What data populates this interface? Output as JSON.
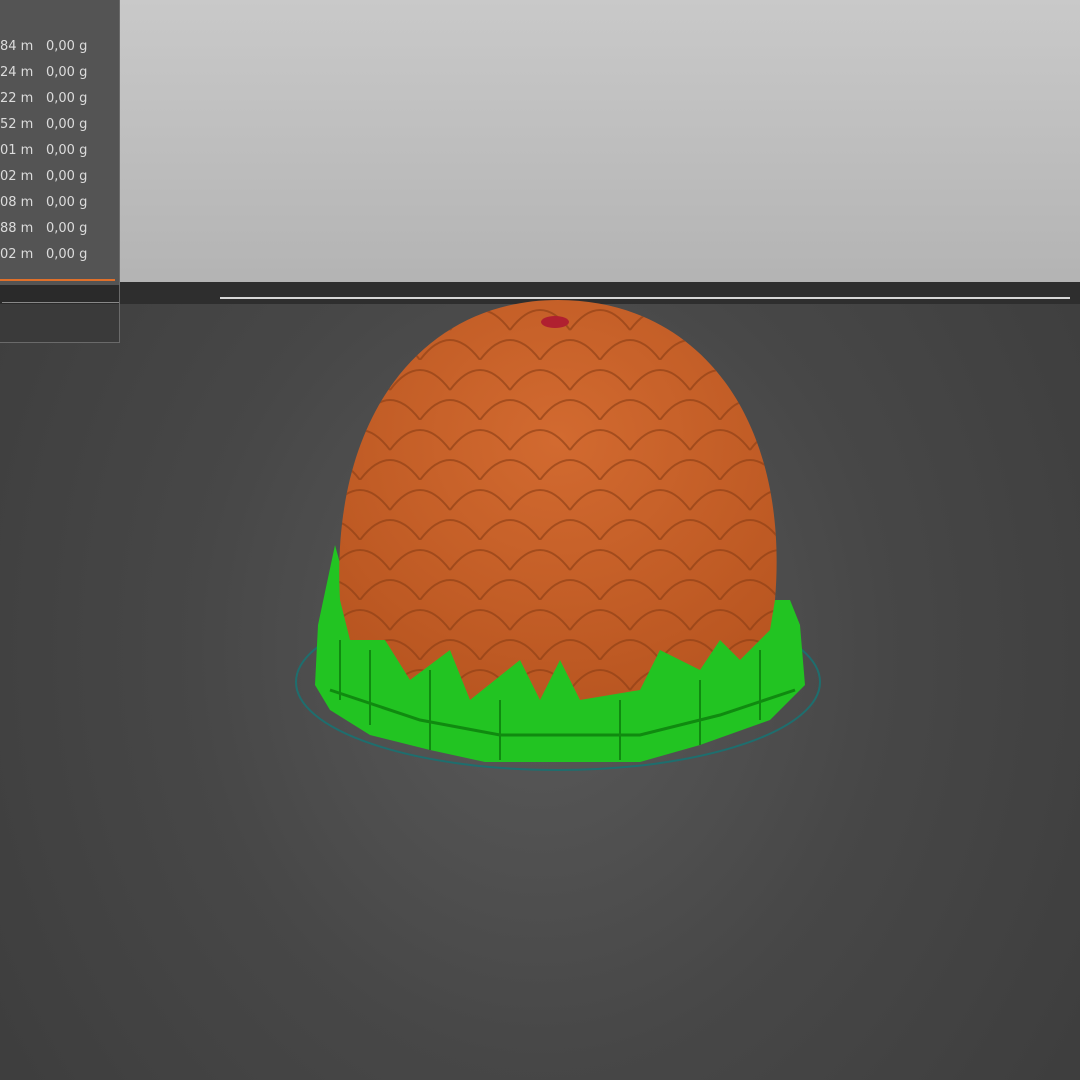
{
  "stats_panel": {
    "rows": [
      {
        "length": "84 m",
        "weight": "0,00 g"
      },
      {
        "length": "24 m",
        "weight": "0,00 g"
      },
      {
        "length": "22 m",
        "weight": "0,00 g"
      },
      {
        "length": "52 m",
        "weight": "0,00 g"
      },
      {
        "length": "01 m",
        "weight": "0,00 g"
      },
      {
        "length": "02 m",
        "weight": "0,00 g"
      },
      {
        "length": "08 m",
        "weight": "0,00 g"
      },
      {
        "length": "88 m",
        "weight": "0,00 g"
      },
      {
        "length": "02 m",
        "weight": "0,00 g"
      }
    ]
  },
  "colors": {
    "perimeter": "#c8602a",
    "support": "#1ec81e",
    "skirt": "#1e6e6e",
    "accent": "#e0702a"
  }
}
